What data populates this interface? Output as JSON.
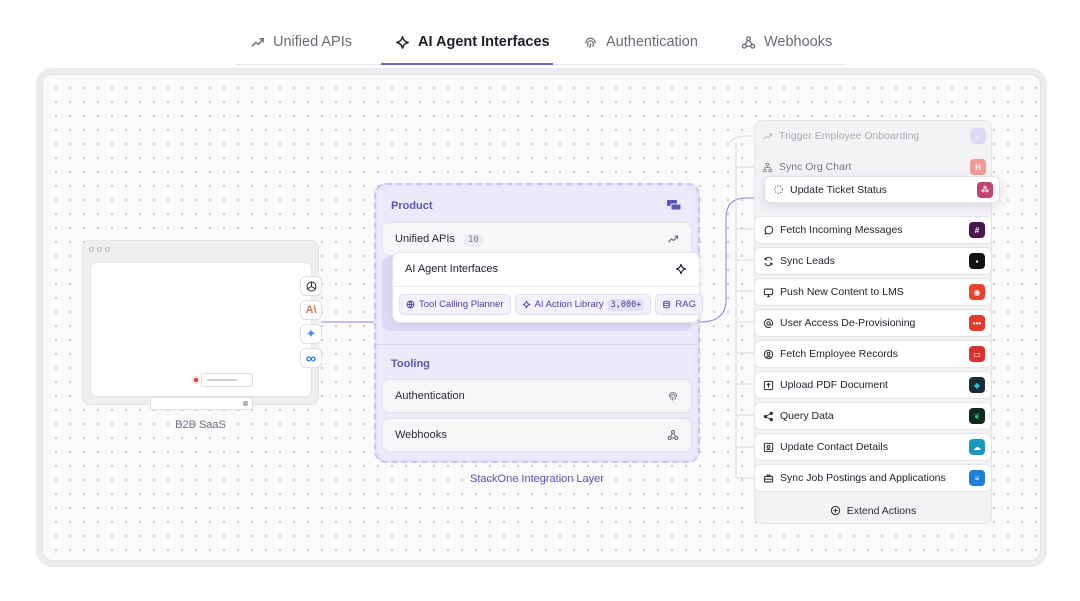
{
  "tabs": [
    {
      "label": "Unified APIs",
      "icon": "trend-arrow-icon",
      "active": false
    },
    {
      "label": "AI Agent Interfaces",
      "icon": "sparkle-icon",
      "active": true
    },
    {
      "label": "Authentication",
      "icon": "fingerprint-icon",
      "active": false
    },
    {
      "label": "Webhooks",
      "icon": "webhook-icon",
      "active": false
    }
  ],
  "saas": {
    "caption": "B2B SaaS",
    "llm_icons": [
      "openai-icon",
      "anthropic-icon",
      "gemini-icon",
      "meta-icon"
    ],
    "anthropic_glyph": "A\\",
    "meta_glyph": "∞",
    "gemini_glyph": "✦"
  },
  "layer": {
    "product_title": "Product",
    "unified_apis_label": "Unified APIs",
    "unified_apis_count": "10",
    "agent_interfaces_label": "AI Agent Interfaces",
    "chips": [
      {
        "label": "Tool Calling Planner",
        "icon": "globe-icon"
      },
      {
        "label": "AI Action Library",
        "icon": "sparkle-icon",
        "count": "3,000+"
      },
      {
        "label": "RAG",
        "icon": "database-icon"
      }
    ],
    "tooling_title": "Tooling",
    "authentication_label": "Authentication",
    "webhooks_label": "Webhooks",
    "caption": "StackOne Integration Layer"
  },
  "actions": [
    {
      "label": "Trigger Employee Onboarding",
      "icon": "trend-arrow-icon",
      "badge_color": "#b9b4f2",
      "badge_text": "✓"
    },
    {
      "label": "Sync Org Chart",
      "icon": "org-chart-icon",
      "badge_color": "#f25f5c",
      "badge_text": "H"
    },
    {
      "label": "Update Ticket Status",
      "icon": "loading-icon",
      "badge_color": "#c2436b",
      "badge_text": "⁂"
    },
    {
      "label": "Fetch Incoming Messages",
      "icon": "chat-icon",
      "badge_color": "#4a154b",
      "badge_text": "#"
    },
    {
      "label": "Sync Leads",
      "icon": "refresh-icon",
      "badge_color": "#111111",
      "badge_text": "▪"
    },
    {
      "label": "Push New Content to LMS",
      "icon": "monitor-icon",
      "badge_color": "#e8432e",
      "badge_text": "◉"
    },
    {
      "label": "User Access De-Provisioning",
      "icon": "at-sign-icon",
      "badge_color": "#e23b2e",
      "badge_text": "•••"
    },
    {
      "label": "Fetch Employee Records",
      "icon": "users-icon",
      "badge_color": "#d9322e",
      "badge_text": "▭"
    },
    {
      "label": "Upload PDF Document",
      "icon": "upload-icon",
      "badge_color": "#1c2b3a",
      "badge_text": "◆"
    },
    {
      "label": "Query Data",
      "icon": "share-icon",
      "badge_color": "#0f2a1e",
      "badge_text": "❦"
    },
    {
      "label": "Update Contact Details",
      "icon": "contact-card-icon",
      "badge_color": "#1798c1",
      "badge_text": "☁"
    },
    {
      "label": "Sync Job Postings and Applications",
      "icon": "briefcase-icon",
      "badge_color": "#1f7fd6",
      "badge_text": "≡"
    }
  ],
  "extend_label": "Extend Actions",
  "colors": {
    "accent": "#6a63c9",
    "layer_bg": "#ebe9fa",
    "layer_text": "#5b55b5"
  }
}
